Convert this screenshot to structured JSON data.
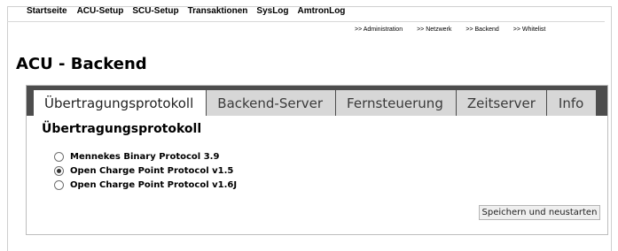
{
  "topnav": {
    "items": [
      "Startseite",
      "ACU-Setup",
      "SCU-Setup",
      "Transaktionen",
      "SysLog",
      "AmtronLog"
    ]
  },
  "subnav": {
    "items": [
      ">> Administration",
      ">> Netzwerk",
      ">> Backend",
      ">> Whitelist"
    ]
  },
  "page": {
    "title": "ACU - Backend"
  },
  "tabs": [
    {
      "label": "Übertragungsprotokoll",
      "active": true
    },
    {
      "label": "Backend-Server",
      "active": false
    },
    {
      "label": "Fernsteuerung",
      "active": false
    },
    {
      "label": "Zeitserver",
      "active": false
    },
    {
      "label": "Info",
      "active": false
    }
  ],
  "section": {
    "title": "Übertragungsprotokoll"
  },
  "protocols": {
    "options": [
      {
        "label": "Mennekes Binary Protocol 3.9",
        "selected": false
      },
      {
        "label": "Open Charge Point Protocol v1.5",
        "selected": true
      },
      {
        "label": "Open Charge Point Protocol v1.6J",
        "selected": false
      }
    ]
  },
  "actions": {
    "save_label": "Speichern und neustarten"
  },
  "colors": {
    "tabbar_bg": "#4d4d4d",
    "tab_inactive_bg": "#d7d7d7",
    "tab_active_bg": "#ffffff"
  }
}
